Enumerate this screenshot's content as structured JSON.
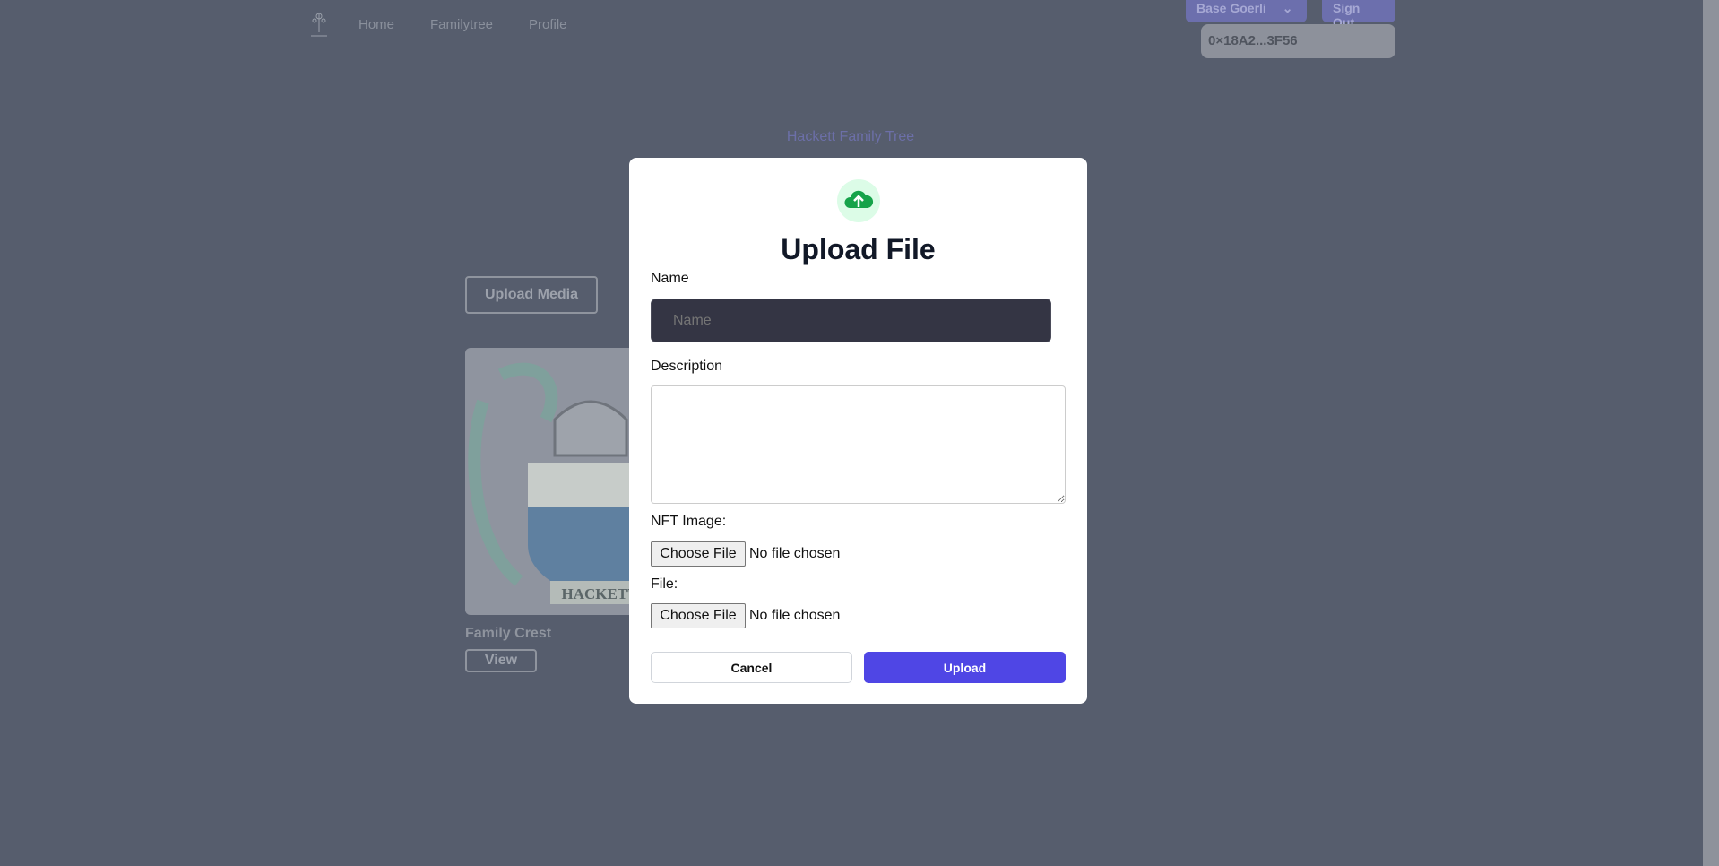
{
  "nav": {
    "logo": "tree-logo",
    "items": [
      "Home",
      "Familytree",
      "Profile"
    ]
  },
  "header": {
    "network": "Base Goerli",
    "sign_out": "Sign Out",
    "address": "0×18A2...3F56"
  },
  "page": {
    "subtitle": "Hackett Family Tree",
    "upload_media": "Upload Media",
    "card": {
      "title": "Family Crest",
      "view": "View",
      "crest_text": "HACKETT"
    }
  },
  "modal": {
    "icon": "cloud-upload-icon",
    "title": "Upload File",
    "name_label": "Name",
    "name_placeholder": "Name",
    "name_value": "",
    "description_label": "Description",
    "nft_label": "NFT Image:",
    "file_label": "File:",
    "choose_file": "Choose File",
    "no_file": "No file chosen",
    "cancel": "Cancel",
    "upload": "Upload"
  },
  "colors": {
    "accent": "#4f46e5",
    "icon_green": "#16a34a",
    "input_dark": "#343544"
  }
}
